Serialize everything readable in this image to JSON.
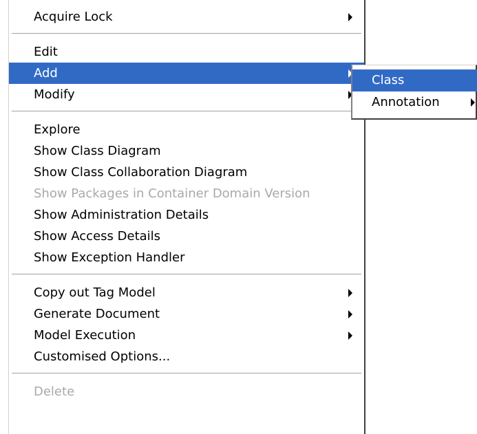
{
  "main_menu": {
    "groups": [
      {
        "items": [
          {
            "label": "Acquire Lock",
            "has_submenu": true,
            "enabled": true
          }
        ]
      },
      {
        "items": [
          {
            "label": "Edit",
            "has_submenu": false,
            "enabled": true
          },
          {
            "label": "Add",
            "has_submenu": true,
            "enabled": true,
            "highlighted": true
          },
          {
            "label": "Modify",
            "has_submenu": true,
            "enabled": true
          }
        ]
      },
      {
        "items": [
          {
            "label": "Explore",
            "has_submenu": false,
            "enabled": true
          },
          {
            "label": "Show Class Diagram",
            "has_submenu": false,
            "enabled": true
          },
          {
            "label": "Show Class Collaboration Diagram",
            "has_submenu": false,
            "enabled": true
          },
          {
            "label": "Show Packages in Container Domain Version",
            "has_submenu": false,
            "enabled": false
          },
          {
            "label": "Show Administration Details",
            "has_submenu": false,
            "enabled": true
          },
          {
            "label": "Show Access Details",
            "has_submenu": false,
            "enabled": true
          },
          {
            "label": "Show Exception Handler",
            "has_submenu": false,
            "enabled": true
          }
        ]
      },
      {
        "items": [
          {
            "label": "Copy out Tag Model",
            "has_submenu": true,
            "enabled": true
          },
          {
            "label": "Generate Document",
            "has_submenu": true,
            "enabled": true
          },
          {
            "label": "Model Execution",
            "has_submenu": true,
            "enabled": true
          },
          {
            "label": "Customised Options...",
            "has_submenu": false,
            "enabled": true
          }
        ]
      },
      {
        "items": [
          {
            "label": "Delete",
            "has_submenu": false,
            "enabled": false
          }
        ]
      }
    ]
  },
  "add_submenu": {
    "items": [
      {
        "label": "Class",
        "has_submenu": false,
        "enabled": true,
        "highlighted": true
      },
      {
        "label": "Annotation",
        "has_submenu": true,
        "enabled": true
      }
    ]
  },
  "colors": {
    "highlight": "#316ac5",
    "disabled_text": "#a9a9a9",
    "menu_background": "#ffffff"
  },
  "icons": {
    "submenu_arrow": "submenu-arrow-icon"
  }
}
